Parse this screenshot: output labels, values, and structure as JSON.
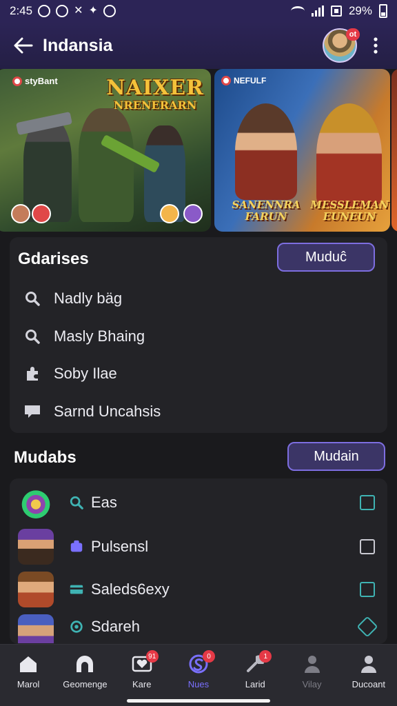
{
  "status_bar": {
    "time": "2:45",
    "battery": "29%"
  },
  "app_bar": {
    "title": "Indansia",
    "avatar_badge": "ot"
  },
  "banners": [
    {
      "brand": "styBant",
      "headline_1": "NAIXER",
      "headline_2": "NRENERARN"
    },
    {
      "brand": "NEFULF",
      "title_left_1": "SANENNRA",
      "title_left_2": "FARUN",
      "title_right_1": "MESSLEMAN",
      "title_right_2": "EUNEUN"
    }
  ],
  "gdarises": {
    "title": "Gdarises",
    "button_label": "Muduĉ",
    "items": [
      {
        "label": "Nadly bäg",
        "icon": "search-icon"
      },
      {
        "label": "Masly Bhaing",
        "icon": "search-icon"
      },
      {
        "label": "Soby Ilae",
        "icon": "puzzle-icon"
      },
      {
        "label": "Sarnd Uncahsis",
        "icon": "message-icon"
      }
    ]
  },
  "mudabs": {
    "title": "Mudabs",
    "button_label": "Mudain",
    "items": [
      {
        "label": "Eas",
        "icon": "search-icon"
      },
      {
        "label": "Pulsensl",
        "icon": "tag-icon"
      },
      {
        "label": "Saleds6exy",
        "icon": "card-icon"
      },
      {
        "label": "Sdareh",
        "icon": "refresh-icon"
      }
    ]
  },
  "bottom_nav": [
    {
      "label": "Marol",
      "icon": "home-icon"
    },
    {
      "label": "Geomenge",
      "icon": "arch-icon"
    },
    {
      "label": "Kare",
      "icon": "heart-icon",
      "badge": "91"
    },
    {
      "label": "Nues",
      "icon": "s-logo-icon",
      "badge": "0"
    },
    {
      "label": "Larid",
      "icon": "wrench-icon",
      "badge": "1"
    },
    {
      "label": "Vilay",
      "icon": "person-icon"
    },
    {
      "label": "Ducoant",
      "icon": "user-icon"
    }
  ],
  "colors": {
    "accent": "#7a70ff",
    "app_bar": "#2c2456",
    "background": "#1a1a1d",
    "card": "#232327",
    "badge": "#e53946",
    "checkbox": "#3fb3b3"
  }
}
